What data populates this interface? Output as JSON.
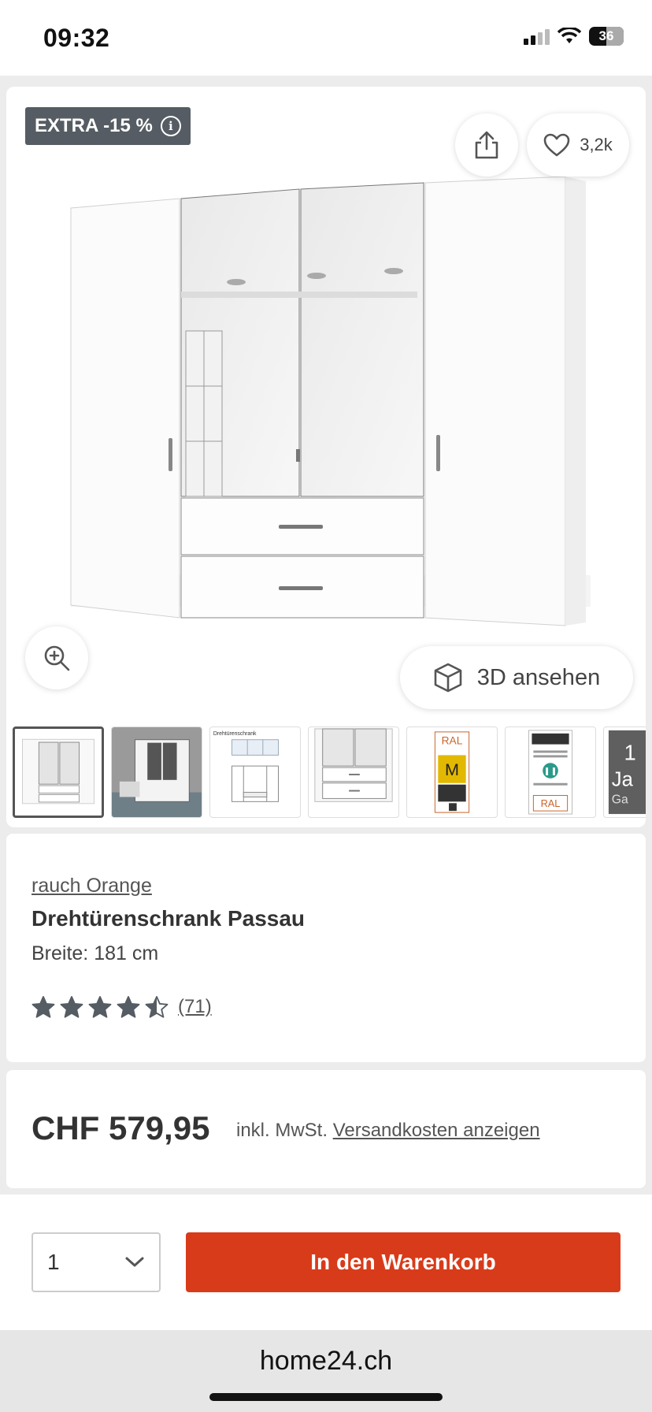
{
  "status_bar": {
    "time": "09:32",
    "battery": "36"
  },
  "product_gallery": {
    "badge": "EXTRA -15 %",
    "favorites_count": "3,2k",
    "view_3d_label": "3D ansehen",
    "thumbnails": [
      "thumb-front",
      "thumb-room",
      "thumb-dimensions",
      "thumb-detail",
      "thumb-ral-seal",
      "thumb-made-in-germany",
      "thumb-warranty"
    ]
  },
  "product": {
    "brand": "rauch Orange",
    "title": "Drehtürenschrank Passau",
    "width": "Breite: 181 cm",
    "rating": 4.5,
    "review_count": "(71)"
  },
  "pricing": {
    "price": "CHF 579,95",
    "tax_note": "inkl. MwSt.",
    "shipping_link": "Versandkosten anzeigen"
  },
  "cart": {
    "quantity": "1",
    "add_to_cart_label": "In den Warenkorb"
  },
  "browser": {
    "url": "home24.ch"
  },
  "colors": {
    "accent": "#d83b1a",
    "badge_bg": "#555c63",
    "star": "#555c63"
  }
}
